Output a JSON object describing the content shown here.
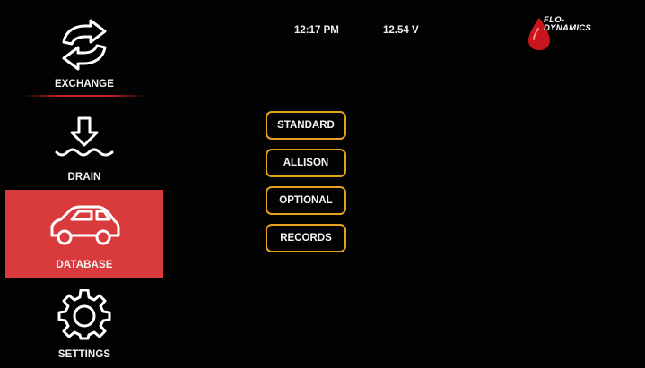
{
  "header": {
    "time": "12:17 PM",
    "voltage": "12.54 V",
    "logo_text_line1": "FLO-",
    "logo_text_line2": "DYNAMICS"
  },
  "sidebar": {
    "items": [
      {
        "label": "EXCHANGE",
        "icon": "exchange-arrows-icon",
        "active": false
      },
      {
        "label": "DRAIN",
        "icon": "drain-arrow-icon",
        "active": false
      },
      {
        "label": "DATABASE",
        "icon": "car-icon",
        "active": true
      },
      {
        "label": "SETTINGS",
        "icon": "gear-icon",
        "active": false
      }
    ]
  },
  "menu": {
    "buttons": [
      {
        "label": "STANDARD"
      },
      {
        "label": "ALLISON"
      },
      {
        "label": "OPTIONAL"
      },
      {
        "label": "RECORDS"
      }
    ]
  },
  "colors": {
    "active_bg": "#d93a3c",
    "button_border": "#e5a21e",
    "accent_red": "#c8161d",
    "background": "#020202"
  }
}
